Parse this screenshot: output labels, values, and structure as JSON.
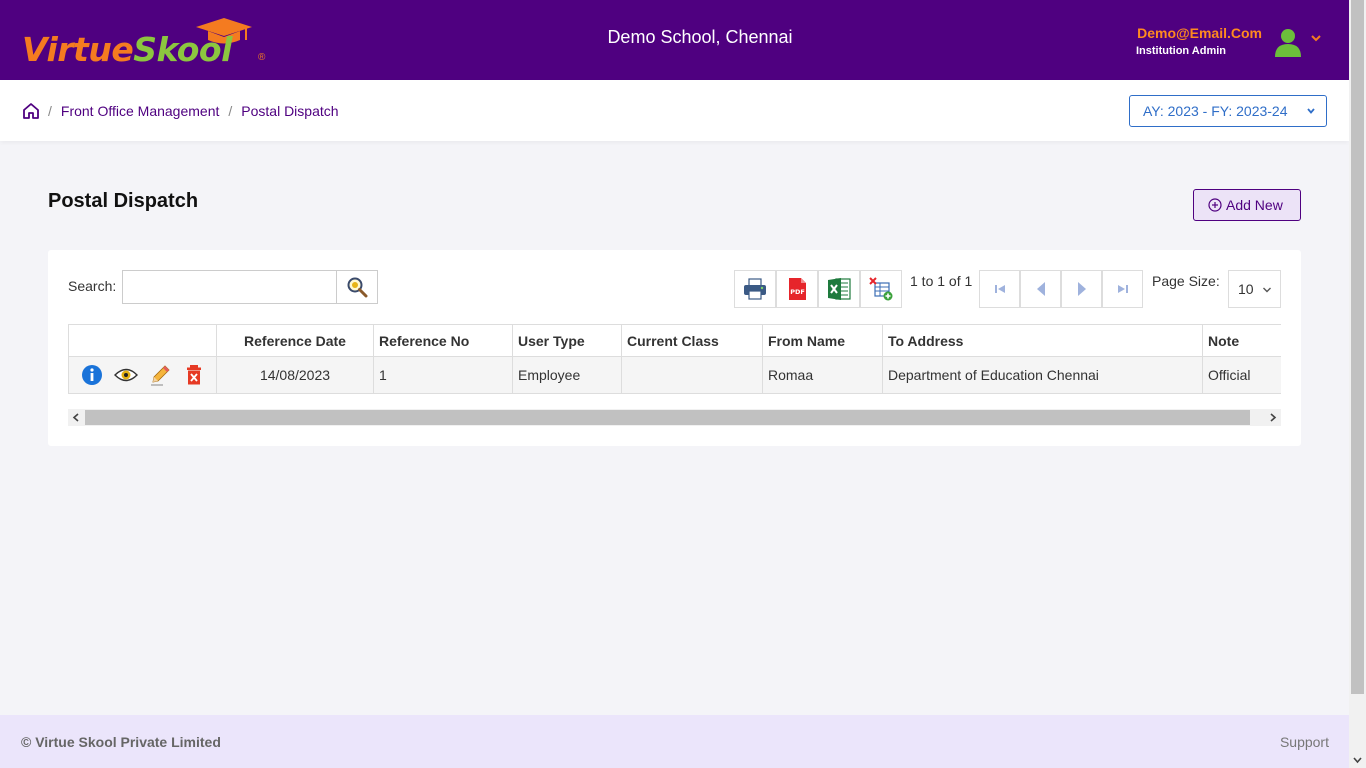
{
  "header": {
    "logo_virtue": "Virtue",
    "logo_skool": "Skool",
    "logo_reg": "®",
    "school_name": "Demo School, Chennai",
    "user_email": "Demo@Email.Com",
    "user_role": "Institution Admin",
    "icons": [
      "graduation-cap-icon",
      "user-avatar-icon",
      "chevron-down-icon"
    ],
    "colors": {
      "brand": "#4f0080",
      "orange": "#f47b20",
      "green": "#8cc63f"
    }
  },
  "breadcrumb": {
    "items": [
      "Front Office Management",
      "Postal Dispatch"
    ],
    "separator": "/",
    "home_icon": "home-icon"
  },
  "academic_year": {
    "label": "AY: 2023 - FY: 2023-24"
  },
  "page": {
    "title": "Postal Dispatch",
    "add_new": "Add New"
  },
  "grid": {
    "search_label": "Search:",
    "search_value": "",
    "pager_text": "1 to 1 of 1",
    "page_size_label": "Page Size:",
    "page_size": "10",
    "columns": [
      "",
      "Reference Date",
      "Reference No",
      "User Type",
      "Current Class",
      "From Name",
      "To Address",
      "Note"
    ],
    "rows": [
      {
        "reference_date": "14/08/2023",
        "reference_no": "1",
        "user_type": "Employee",
        "current_class": "",
        "from_name": "Romaa",
        "to_address": "Department of Education Chennai",
        "note": "Official"
      }
    ],
    "toolbar_icons": [
      "print-icon",
      "pdf-icon",
      "excel-icon",
      "column-chooser-icon"
    ],
    "row_action_icons": [
      "info-icon",
      "view-icon",
      "edit-icon",
      "delete-icon"
    ]
  },
  "footer": {
    "copyright": "© Virtue Skool Private Limited",
    "support": "Support"
  }
}
